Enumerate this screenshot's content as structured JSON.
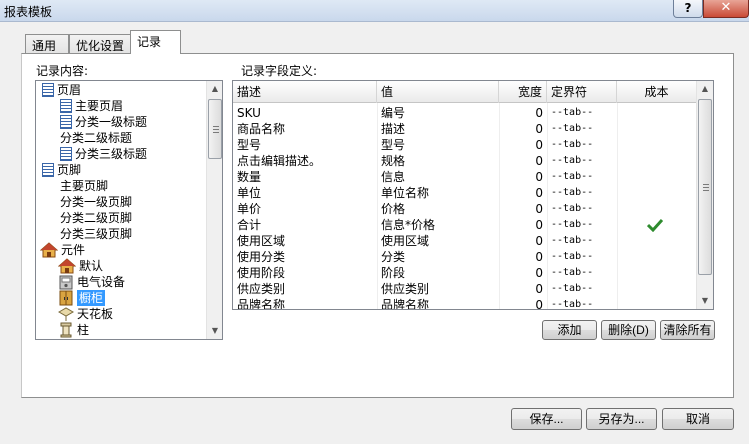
{
  "window": {
    "title": "报表模板",
    "help_label": "?",
    "close_label": "✕"
  },
  "tabs": [
    {
      "label": "通用"
    },
    {
      "label": "优化设置"
    },
    {
      "label": "记录"
    }
  ],
  "tree": {
    "label": "记录内容:",
    "items": [
      {
        "label": "页眉",
        "icon": "page-icon"
      },
      {
        "label": "主要页眉",
        "icon": "page-icon"
      },
      {
        "label": "分类一级标题",
        "icon": "page-icon"
      },
      {
        "label": "分类二级标题",
        "icon": ""
      },
      {
        "label": "分类三级标题",
        "icon": "page-icon"
      },
      {
        "label": "页脚",
        "icon": "page-icon"
      },
      {
        "label": "主要页脚",
        "icon": ""
      },
      {
        "label": "分类一级页脚",
        "icon": ""
      },
      {
        "label": "分类二级页脚",
        "icon": ""
      },
      {
        "label": "分类三级页脚",
        "icon": ""
      },
      {
        "label": "元件",
        "icon": "house-icon"
      },
      {
        "label": "默认",
        "icon": "house-icon"
      },
      {
        "label": "电气设备",
        "icon": "appliance-icon"
      },
      {
        "label": "橱柜",
        "icon": "cabinet-icon",
        "selected": true
      },
      {
        "label": "天花板",
        "icon": "ceiling-icon"
      },
      {
        "label": "柱",
        "icon": "column-icon"
      }
    ]
  },
  "fields": {
    "label": "记录字段定义:",
    "columns": [
      "描述",
      "值",
      "宽度",
      "定界符",
      "成本"
    ],
    "rows": [
      {
        "desc": "SKU",
        "value": "编号",
        "width": "0",
        "delim": "--tab--",
        "cost": false
      },
      {
        "desc": "商品名称",
        "value": "描述",
        "width": "0",
        "delim": "--tab--",
        "cost": false
      },
      {
        "desc": "型号",
        "value": "型号",
        "width": "0",
        "delim": "--tab--",
        "cost": false
      },
      {
        "desc": "点击编辑描述。",
        "value": "规格",
        "width": "0",
        "delim": "--tab--",
        "cost": false
      },
      {
        "desc": "数量",
        "value": "信息",
        "width": "0",
        "delim": "--tab--",
        "cost": false
      },
      {
        "desc": "单位",
        "value": "单位名称",
        "width": "0",
        "delim": "--tab--",
        "cost": false
      },
      {
        "desc": "单价",
        "value": "价格",
        "width": "0",
        "delim": "--tab--",
        "cost": false
      },
      {
        "desc": "合计",
        "value": "信息*价格",
        "width": "0",
        "delim": "--tab--",
        "cost": true
      },
      {
        "desc": "使用区域",
        "value": "使用区域",
        "width": "0",
        "delim": "--tab--",
        "cost": false
      },
      {
        "desc": "使用分类",
        "value": "分类",
        "width": "0",
        "delim": "--tab--",
        "cost": false
      },
      {
        "desc": "使用阶段",
        "value": "阶段",
        "width": "0",
        "delim": "--tab--",
        "cost": false
      },
      {
        "desc": "供应类别",
        "value": "供应类别",
        "width": "0",
        "delim": "--tab--",
        "cost": false
      },
      {
        "desc": "品牌名称",
        "value": "品牌名称",
        "width": "0",
        "delim": "--tab--",
        "cost": false
      }
    ],
    "buttons": {
      "add": "添加",
      "delete": "删除(D)",
      "clear": "清除所有"
    }
  },
  "footer": {
    "save": "保存...",
    "save_as": "另存为...",
    "cancel": "取消"
  },
  "colors": {
    "selection": "#3399ff",
    "check": "#2e8b2e"
  }
}
